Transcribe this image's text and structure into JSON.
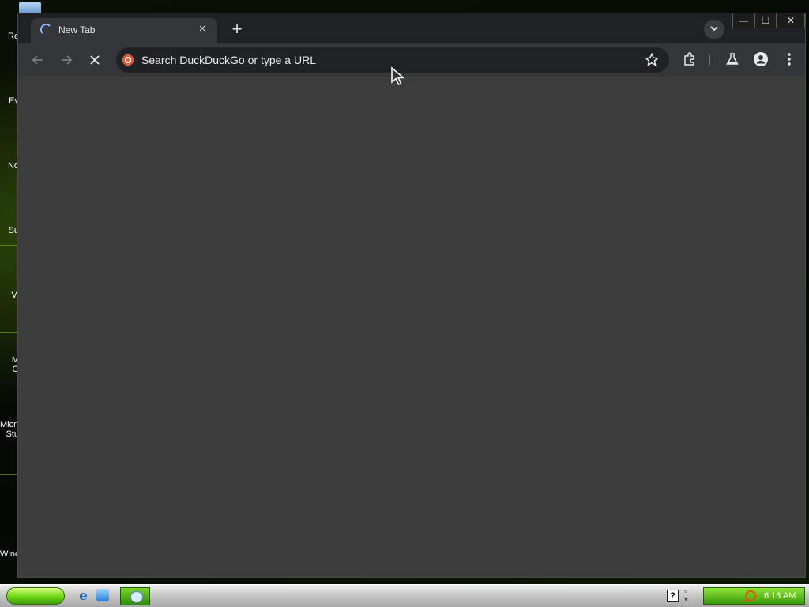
{
  "desktop": {
    "icons": [
      {
        "label": "Re"
      },
      {
        "label": "Ev"
      },
      {
        "label": "No"
      },
      {
        "label": "Su"
      },
      {
        "label": "Vi"
      },
      {
        "label": "M"
      },
      {
        "label": "O"
      },
      {
        "label": "Micro"
      },
      {
        "label": "Stu"
      },
      {
        "label": "Wind"
      }
    ]
  },
  "browser": {
    "tab": {
      "title": "New Tab",
      "close_glyph": "×",
      "loading_icon": "spinner-icon"
    },
    "new_tab_glyph": "+",
    "window_controls": {
      "minimize": "—",
      "maximize": "☐",
      "close": "✕"
    },
    "omnibox": {
      "placeholder": "Search DuckDuckGo or type a URL",
      "search_engine_icon": "duckduckgo-icon"
    },
    "toolbar_icons": [
      "back-icon",
      "forward-icon",
      "stop-icon",
      "bookmark-star-icon",
      "extensions-icon",
      "labs-flask-icon",
      "profile-icon",
      "menu-icon"
    ]
  },
  "taskbar": {
    "tray": {
      "clock": "6:13 AM"
    },
    "help_glyph": "?"
  },
  "colors": {
    "tab_strip": "#202124",
    "toolbar": "#35363a",
    "content": "#3c3c3d",
    "taskbar_accent": "#6cd615"
  }
}
